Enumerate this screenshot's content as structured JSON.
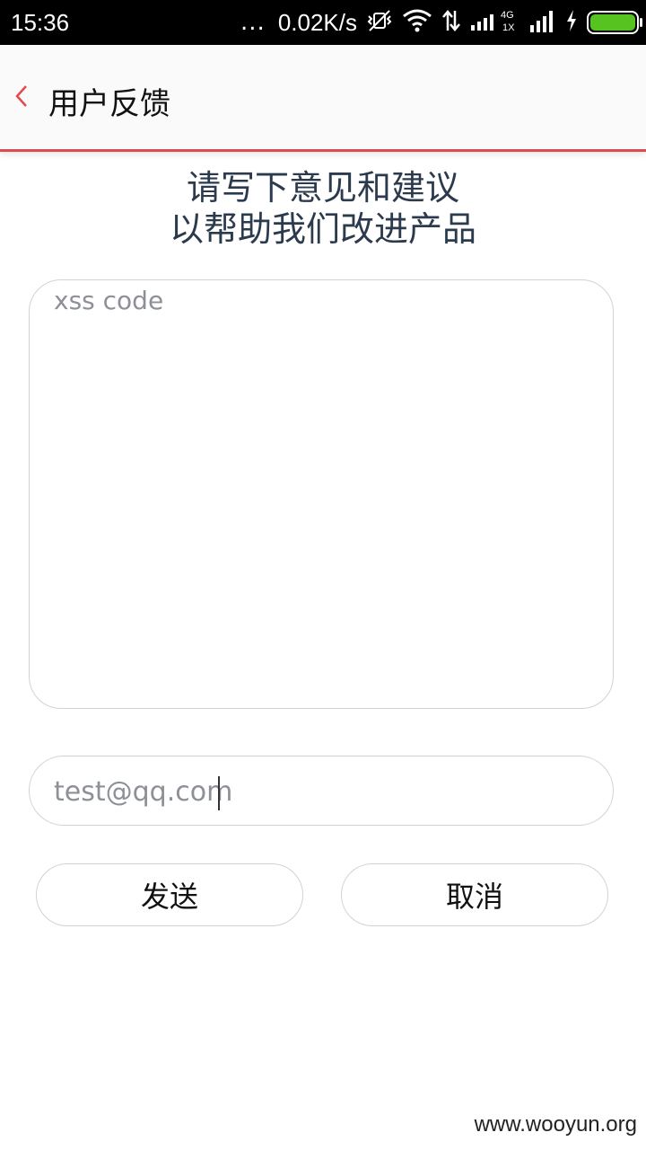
{
  "status_bar": {
    "time": "15:36",
    "dots": "...",
    "speed": "0.02K/s",
    "network_label": "4G\n1X",
    "battery_color": "#56c321"
  },
  "header": {
    "title": "用户反馈",
    "accent_color": "#e14b4b"
  },
  "description": {
    "line1": "请写下意见和建议",
    "line2": "以帮助我们改进产品"
  },
  "feedback": {
    "value": "xss code"
  },
  "email": {
    "value": "test@qq.com"
  },
  "buttons": {
    "send": "发送",
    "cancel": "取消"
  },
  "watermark": "www.wooyun.org"
}
